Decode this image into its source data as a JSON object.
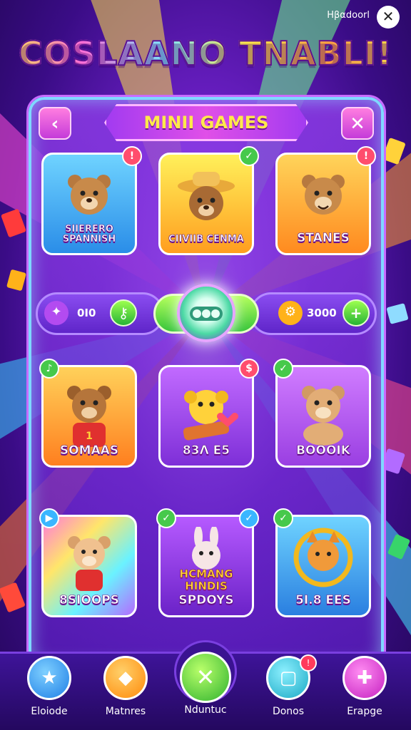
{
  "header": {
    "title": "COSLAANO TNABLI!",
    "user_label": "Ηβαdoorl",
    "close_symbol": "✕"
  },
  "panel": {
    "section_title": "MINII GAMES",
    "back_symbol": "‹",
    "close_symbol": "✕"
  },
  "games": [
    {
      "label": "SIIERERO SPANNISH",
      "icon": "bear-waving-icon",
      "color": "#3ab6ff",
      "badge_color": "#ff4d6d"
    },
    {
      "label": "CIIVIIB CENMA",
      "icon": "bear-hat-icon",
      "color": "#ffb730",
      "badge_color": "#46c94b"
    },
    {
      "label": "STANES",
      "icon": "bear-happy-icon",
      "color": "#ff9b2f",
      "badge_color": "#ff4d6d"
    },
    {
      "label": "SOMAAS",
      "icon": "bear-jersey-icon",
      "color": "#ff9a2f",
      "badge_color": "#46c94b"
    },
    {
      "label": "83Λ E5",
      "icon": "yellow-pup-icon",
      "color": "#a84ae6",
      "badge_color": "#ff4d6d"
    },
    {
      "label": "BOOOIK",
      "icon": "bear-sitting-icon",
      "color": "#b25fea",
      "badge_color": "#46c94b"
    },
    {
      "label": "8SIOOPS",
      "icon": "bear-rainbow-icon",
      "color": "#ff6bc8",
      "badge_color": "#3ab6ff"
    },
    {
      "label": "SPDOYS",
      "icon": "bunny-icon",
      "color": "#9b3fe3",
      "badge_color": "#46c94b"
    },
    {
      "label": "5I.8 EES",
      "icon": "cat-ring-icon",
      "color": "#3ab6ff",
      "badge_color": "#46c94b"
    }
  ],
  "center_card_text": "HCMANG HINDIS",
  "resources": {
    "left_value": "0I0",
    "right_value": "3000",
    "left_icon": "magic-wand-icon",
    "right_icon": "gear-chip-icon",
    "left_button_icon": "key-icon",
    "right_button_symbol": "+"
  },
  "nav": [
    {
      "label": "Eloiode",
      "icon": "star-icon",
      "color": "#37a7ff"
    },
    {
      "label": "Matnres",
      "icon": "triangle-icon",
      "color": "#ff9f1a"
    },
    {
      "label": "Nduntuc",
      "icon": "cross-icon",
      "color": "#5fd23b"
    },
    {
      "label": "Donos",
      "icon": "cards-icon",
      "color": "#3cc7d8"
    },
    {
      "label": "Erapge",
      "icon": "puzzle-icon",
      "color": "#e04fd8"
    }
  ],
  "nav_badge": "!"
}
